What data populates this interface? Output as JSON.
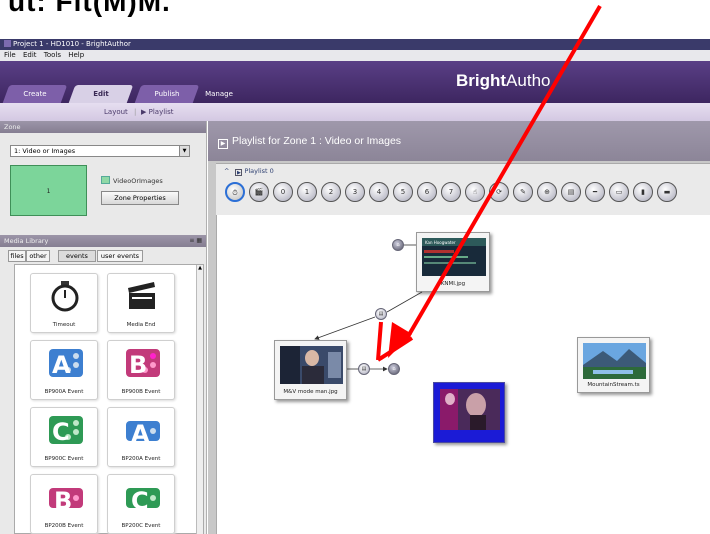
{
  "heading_fragment": "ut: Fit(M)M.",
  "window": {
    "title": "Project 1 - HD1010 - BrightAuthor",
    "menu": [
      "File",
      "Edit",
      "Tools",
      "Help"
    ]
  },
  "header": {
    "brand_bold": "Bright",
    "brand_rest": "Autho",
    "tabs": [
      "Create",
      "Edit",
      "Publish",
      "Manage"
    ],
    "active_tab": "Edit"
  },
  "subnav": {
    "layout": "Layout",
    "separator": "|",
    "playlist": "▶ Playlist"
  },
  "zone": {
    "panel_title": "Zone",
    "selected": "1: Video or Images",
    "thumb_label": "1",
    "type_label": "VideoOrImages",
    "properties_button": "Zone Properties"
  },
  "media_library": {
    "panel_title": "Media Library",
    "view_icons": "≡ ▦",
    "tabs": [
      "files",
      "other",
      "events",
      "user events"
    ],
    "active_tab": "events",
    "items": [
      {
        "label": "Timeout",
        "icon": "stopwatch-icon"
      },
      {
        "label": "Media End",
        "icon": "clapperboard-icon"
      },
      {
        "label": "BP900A Event",
        "icon": "bp900a-icon",
        "glyph": "A"
      },
      {
        "label": "BP900B Event",
        "icon": "bp900b-icon",
        "glyph": "B"
      },
      {
        "label": "BP900C Event",
        "icon": "bp900c-icon",
        "glyph": "C"
      },
      {
        "label": "BP200A Event",
        "icon": "bp200a-icon",
        "glyph": "A"
      },
      {
        "label": "BP200B Event",
        "icon": "bp200b-icon",
        "glyph": "B"
      },
      {
        "label": "BP200C Event",
        "icon": "bp200c-icon",
        "glyph": "C"
      }
    ]
  },
  "playlist": {
    "title": "Playlist for Zone 1 : Video or Images",
    "caret": "^",
    "name": "Playlist 0",
    "toolbar_glyphs": [
      "⏱",
      "🎬",
      "0",
      "1",
      "2",
      "3",
      "4",
      "5",
      "6",
      "7",
      "☝",
      "⟳",
      "✎",
      "⊕",
      "▤",
      "━",
      "▭",
      "▮",
      "▬"
    ],
    "states": [
      {
        "caption": "KNMI.jpg",
        "thumb_text": "Kan Hoogwater"
      },
      {
        "caption": "M&V mode man.jpg"
      },
      {
        "caption": "MountainStream.ts"
      },
      {
        "caption": ""
      }
    ]
  },
  "colors": {
    "header_purple": "#4b3273",
    "zone_green": "#7cd59a",
    "arrow_red": "#ff0000",
    "selected_blue": "#1b1bd6"
  }
}
